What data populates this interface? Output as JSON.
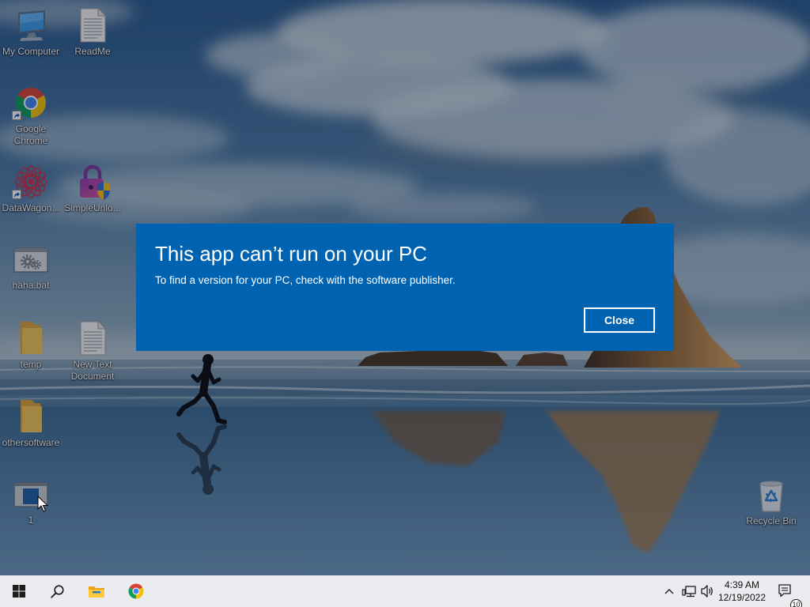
{
  "desktop": {
    "icons": [
      {
        "label": "My Computer",
        "icon": "computer-icon"
      },
      {
        "label": "ReadMe",
        "icon": "text-file-icon"
      },
      {
        "label": "Google Chrome",
        "icon": "chrome-icon",
        "shortcut": true
      },
      {
        "label": "DataWagon...",
        "icon": "datawagon-icon",
        "shortcut": true
      },
      {
        "label": "SimpleUnlo...",
        "icon": "lock-shield-icon"
      },
      {
        "label": "haha.bat",
        "icon": "batch-file-icon"
      },
      {
        "label": "temp",
        "icon": "folder-icon"
      },
      {
        "label": "New Text Document",
        "icon": "text-file-icon"
      },
      {
        "label": "othersoftware",
        "icon": "folder-icon"
      },
      {
        "label": "1",
        "icon": "application-icon"
      },
      {
        "label": "Recycle Bin",
        "icon": "recycle-bin-icon"
      }
    ],
    "cursor": "arrow-cursor-icon"
  },
  "dialog": {
    "title": "This app can’t run on your PC",
    "message": "To find a version for your PC, check with the software publisher.",
    "close_label": "Close",
    "background_color": "#0063b1"
  },
  "taskbar": {
    "background_color": "#eaecef",
    "pinned": [
      {
        "icon": "windows-start-icon"
      },
      {
        "icon": "search-icon"
      },
      {
        "icon": "file-explorer-icon"
      },
      {
        "icon": "chrome-icon"
      }
    ],
    "tray": {
      "icons": [
        "chevron-up-icon",
        "network-icon",
        "volume-icon"
      ],
      "time": "4:39 AM",
      "date": "12/19/2022",
      "notification_icon": "notification-icon",
      "notification_count": "10"
    }
  }
}
